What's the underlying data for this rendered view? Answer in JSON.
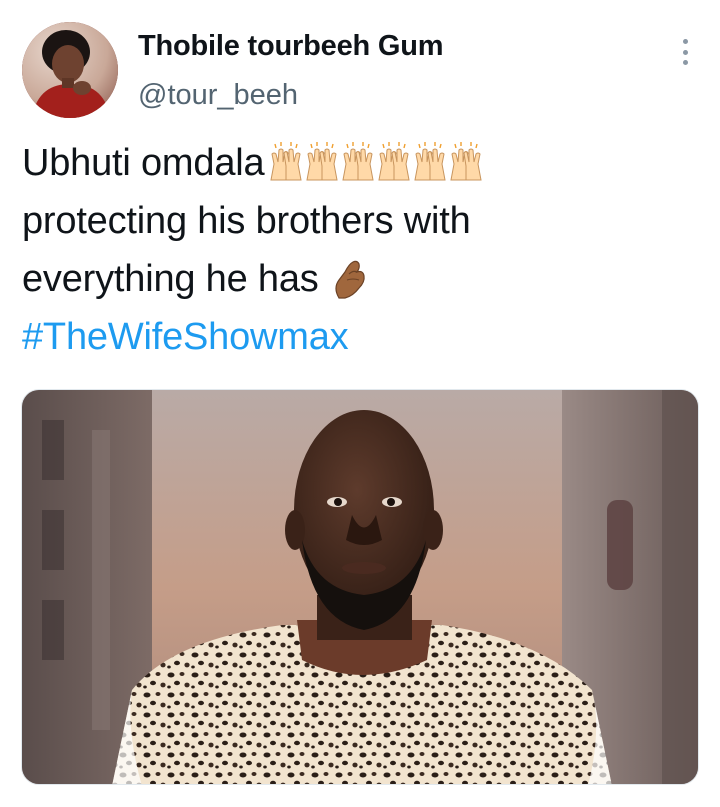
{
  "tweet": {
    "author": {
      "display_name": "Thobile tourbeeh Gum",
      "handle": "@tour_beeh",
      "avatar_icon": "profile-photo"
    },
    "more_icon": "more-vertical-icon",
    "text": {
      "line1": "Ubhuti omdala",
      "line1_emoji": "raising-hands-emoji x6",
      "line2": "protecting his brothers with",
      "line3": "everything he has",
      "line3_emoji": "pinched-fingers-emoji",
      "hashtag": "#TheWifeShowmax"
    },
    "media": {
      "kind": "photo",
      "subject": "man-in-leopard-print-garment"
    }
  },
  "colors": {
    "link": "#1d9bf0",
    "secondary_text": "#536471",
    "primary_text": "#0f1419"
  }
}
